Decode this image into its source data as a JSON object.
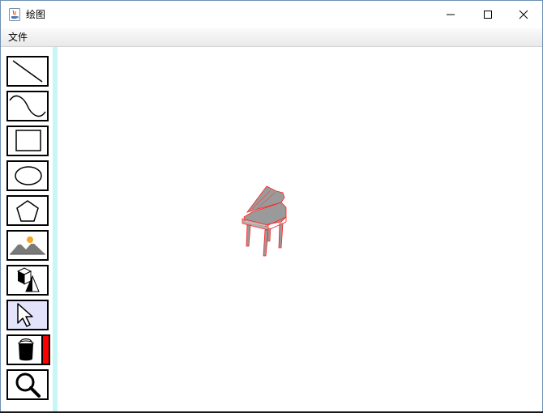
{
  "window": {
    "title": "绘图",
    "icon": "java-icon"
  },
  "title_buttons": {
    "minimize": "minimize-icon",
    "maximize": "maximize-icon",
    "close": "close-icon"
  },
  "menu": {
    "items": [
      {
        "label": "文件"
      }
    ]
  },
  "toolbar": {
    "tools": [
      {
        "name": "line",
        "icon": "line-icon",
        "selected": false
      },
      {
        "name": "curve",
        "icon": "curve-icon",
        "selected": false
      },
      {
        "name": "rectangle",
        "icon": "rectangle-icon",
        "selected": false
      },
      {
        "name": "ellipse",
        "icon": "ellipse-icon",
        "selected": false
      },
      {
        "name": "polygon",
        "icon": "pentagon-icon",
        "selected": false
      },
      {
        "name": "image",
        "icon": "landscape-image-icon",
        "selected": false
      },
      {
        "name": "3d-shape",
        "icon": "cube-cone-icon",
        "selected": false
      },
      {
        "name": "select",
        "icon": "cursor-arrow-icon",
        "selected": true
      },
      {
        "name": "fill",
        "icon": "paint-bucket-icon",
        "selected": false,
        "color": "#ff0000"
      },
      {
        "name": "zoom",
        "icon": "magnifier-icon",
        "selected": false
      }
    ]
  },
  "canvas": {
    "objects": [
      {
        "type": "3d-model",
        "name": "grand-piano",
        "stroke": "#ff0000",
        "fill": "#9a9a9a"
      }
    ]
  },
  "colors": {
    "window_border": "#6d8fb3",
    "toolbar_strip": "#c7f6f6",
    "selected_tool_bg": "#e3e3fb"
  }
}
